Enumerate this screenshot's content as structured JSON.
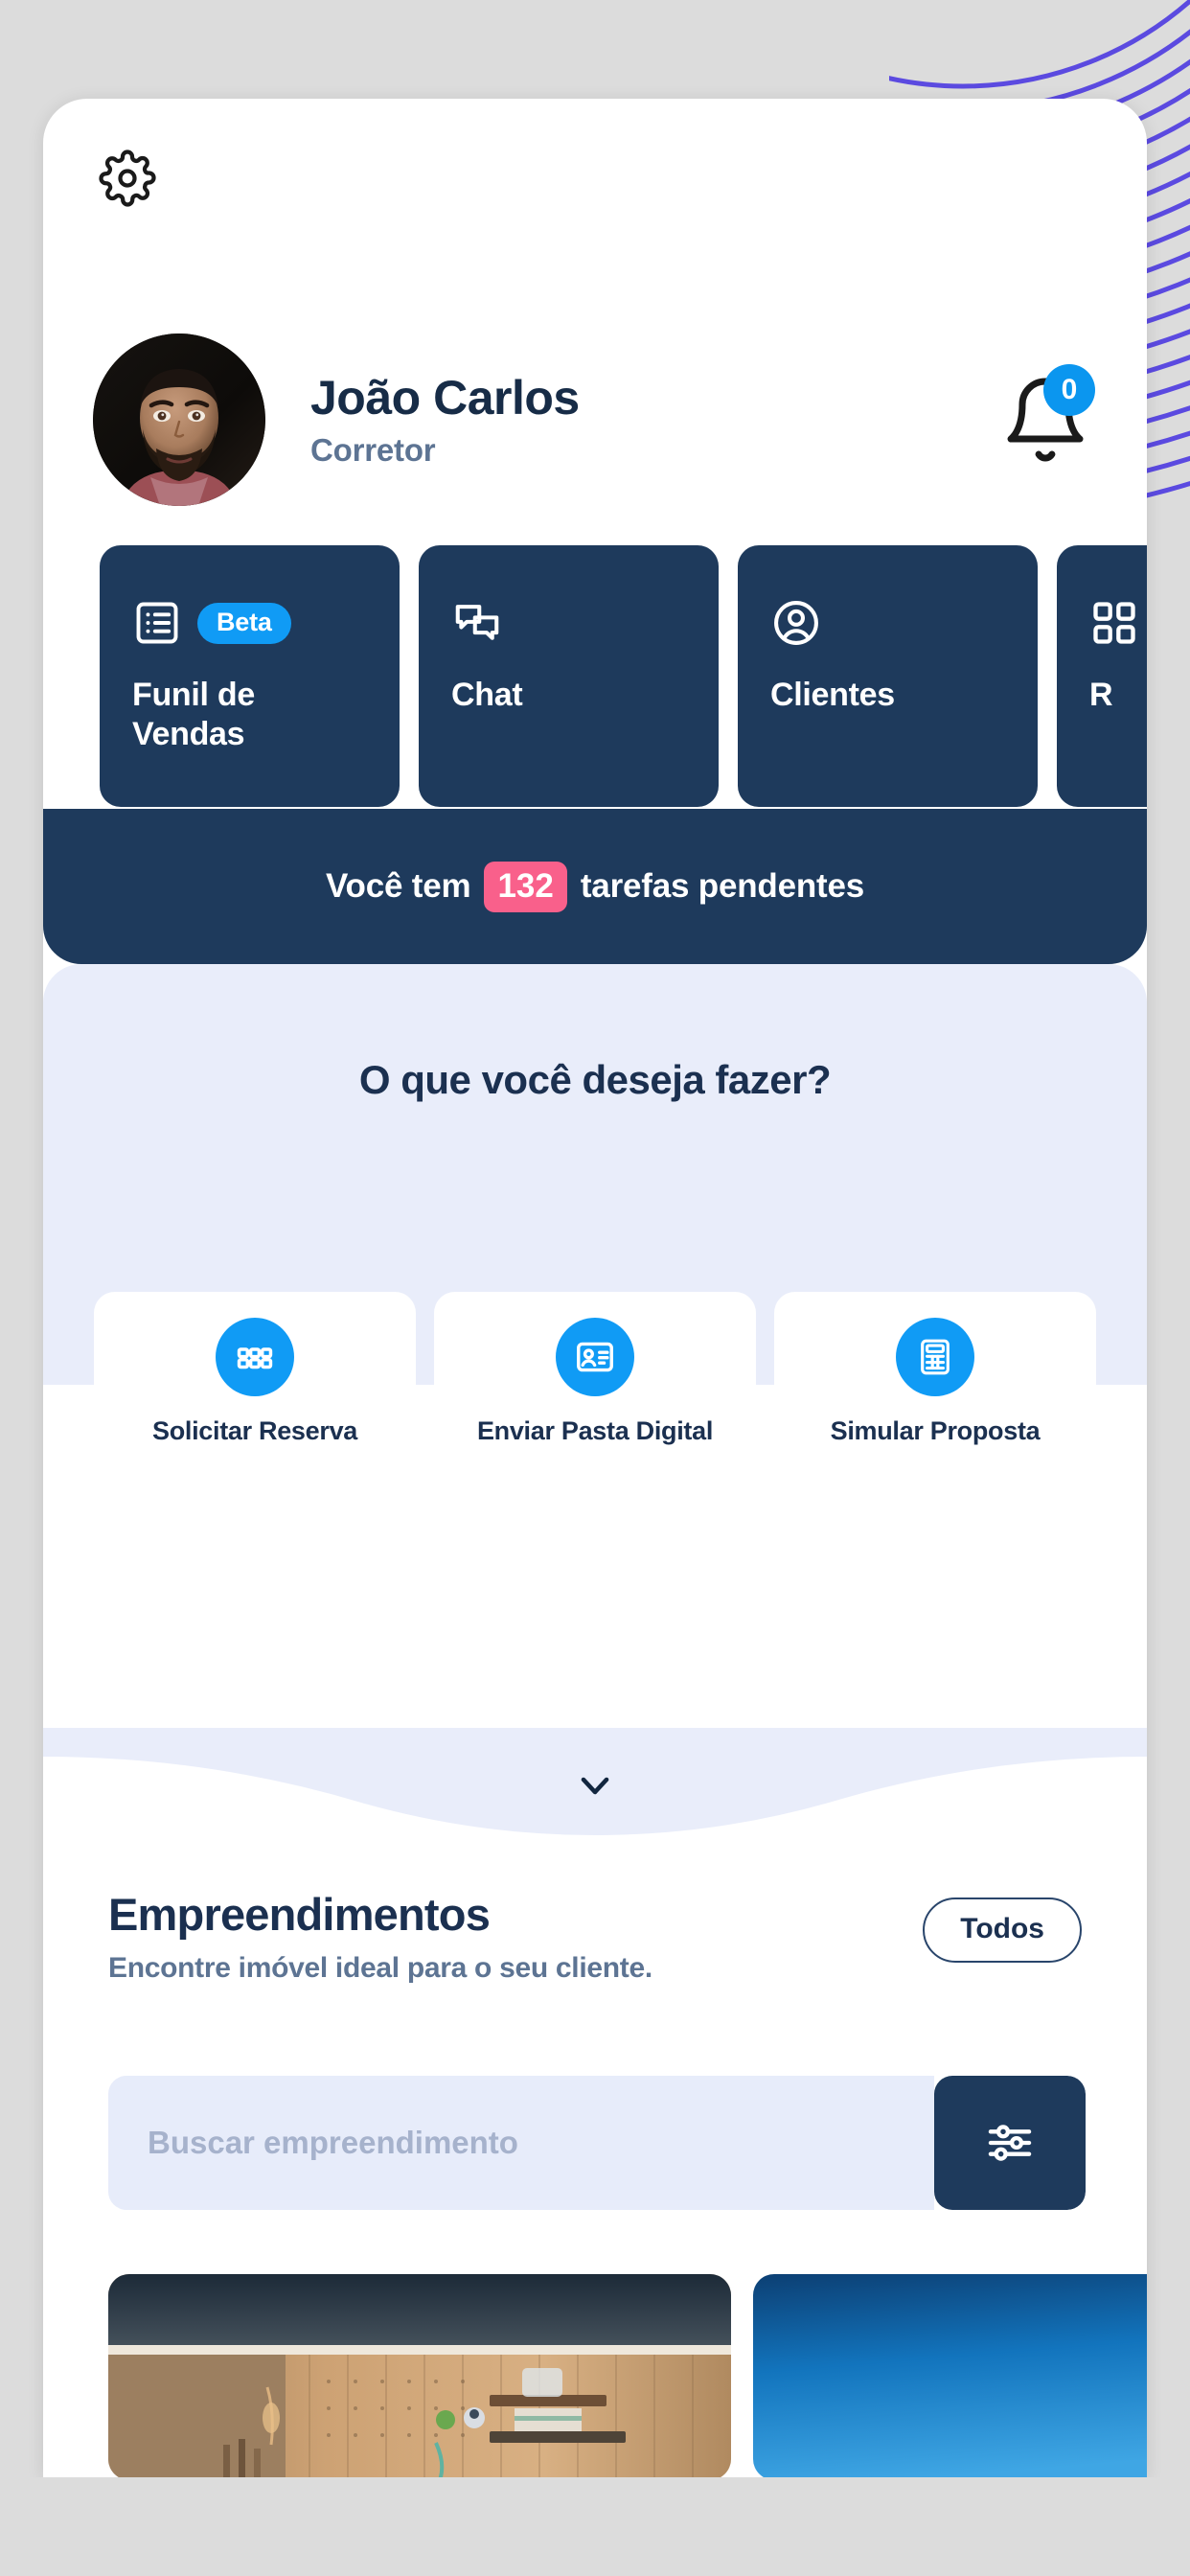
{
  "app": {
    "accent_blue": "#109bf5",
    "navy": "#1e3a5c",
    "pink": "#f9608b",
    "panel_lavender": "#e9edfa",
    "text_navy": "#1b3050",
    "text_slate": "#5d7493",
    "deco_purple": "#5b4ae0"
  },
  "topbar": {
    "settings_icon": "gear-icon"
  },
  "profile": {
    "name": "João Carlos",
    "role": "Corretor",
    "avatar_alt": "avatar",
    "notification_icon": "bell-icon",
    "notification_count": "0"
  },
  "nav_cards": [
    {
      "label": "Funil de Vendas",
      "icon": "list-icon",
      "badge": "Beta"
    },
    {
      "label": "Chat",
      "icon": "chat-bubbles-icon",
      "badge": ""
    },
    {
      "label": "Clientes",
      "icon": "user-circle-icon",
      "badge": ""
    },
    {
      "label": "R",
      "icon": "grid-icon",
      "badge": ""
    }
  ],
  "tasks_banner": {
    "prefix": "Você tem",
    "count": "132",
    "suffix": "tarefas pendentes"
  },
  "actions": {
    "heading": "O que você deseja fazer?",
    "items": [
      {
        "label": "Solicitar Reserva",
        "icon": "grid-six-icon"
      },
      {
        "label": "Enviar Pasta Digital",
        "icon": "id-card-icon"
      },
      {
        "label": "Simular Proposta",
        "icon": "calculator-icon"
      }
    ],
    "expander_icon": "chevron-down-icon"
  },
  "empreendimentos": {
    "title": "Empreendimentos",
    "subtitle": "Encontre imóvel ideal para o seu cliente.",
    "all_button": "Todos",
    "search_placeholder": "Buscar empreendimento",
    "search_value": "",
    "filter_icon": "sliders-icon",
    "cards": [
      {
        "alt": "interior-wood-room-photo"
      },
      {
        "alt": "building-exterior-blue-sky-photo"
      }
    ]
  }
}
